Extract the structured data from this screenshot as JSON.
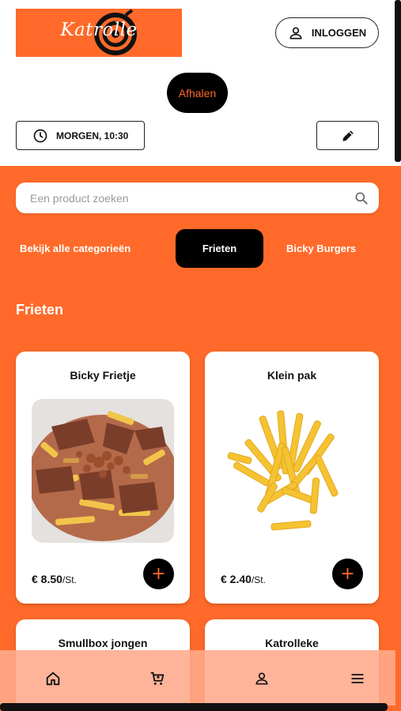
{
  "header": {
    "logo_text": "Katrolle",
    "login_label": "INLOGGEN",
    "login_icon": "user-icon",
    "mode_label": "Afhalen",
    "time_label": "MORGEN, 10:30",
    "time_icon": "clock-icon",
    "edit_icon": "pencil-icon"
  },
  "search": {
    "placeholder": "Een product zoeken",
    "icon": "search-icon"
  },
  "categories": [
    {
      "label": "Bekijk alle categorieën",
      "active": false
    },
    {
      "label": "Frieten",
      "active": true
    },
    {
      "label": "Bicky Burgers",
      "active": false
    }
  ],
  "section_title": "Frieten",
  "products": [
    {
      "name": "Bicky Frietje",
      "price": "€ 8.50",
      "unit": "/St.",
      "add_label": "+"
    },
    {
      "name": "Klein pak",
      "price": "€ 2.40",
      "unit": "/St.",
      "add_label": "+"
    },
    {
      "name": "Smullbox jongen"
    },
    {
      "name": "Katrolleke"
    }
  ],
  "bottom_nav": [
    {
      "icon": "home-icon"
    },
    {
      "icon": "cart-icon"
    },
    {
      "icon": "user-icon"
    },
    {
      "icon": "menu-icon"
    }
  ],
  "colors": {
    "accent": "#ff6a2a",
    "dark": "#000000",
    "surface": "#ffffff"
  }
}
